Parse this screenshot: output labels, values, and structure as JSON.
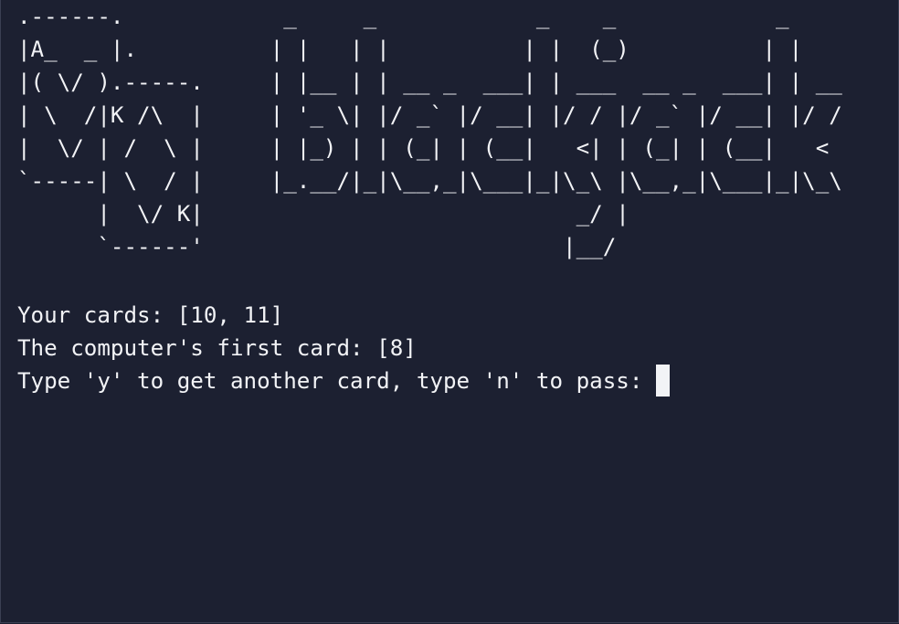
{
  "terminal": {
    "banner": ".------.            _     _            _    _            _\n|A_  _ |.          | |   | |          | |  (_)          | |\n|( \\/ ).-----.     | |__ | | __ _  ___| | ___  __ _  ___| | __\n| \\  /|K /\\  |     | '_ \\| |/ _` |/ __| |/ / |/ _` |/ __| |/ /\n|  \\/ | /  \\ |     | |_) | | (_| | (__|   <| | (_| | (__|   <\n`-----| \\  / |     |_.__/|_|\\__,_|\\___|_|\\_\\ |\\__,_|\\___|_|\\_\\\n      |  \\/ K|                            _/ |\n      `------'                           |__/",
    "lines": {
      "your_cards": "Your cards: [10, 11]",
      "computer_first_card": "The computer's first card: [8]",
      "prompt": "Type 'y' to get another card, type 'n' to pass: "
    },
    "input": {
      "value": ""
    }
  }
}
